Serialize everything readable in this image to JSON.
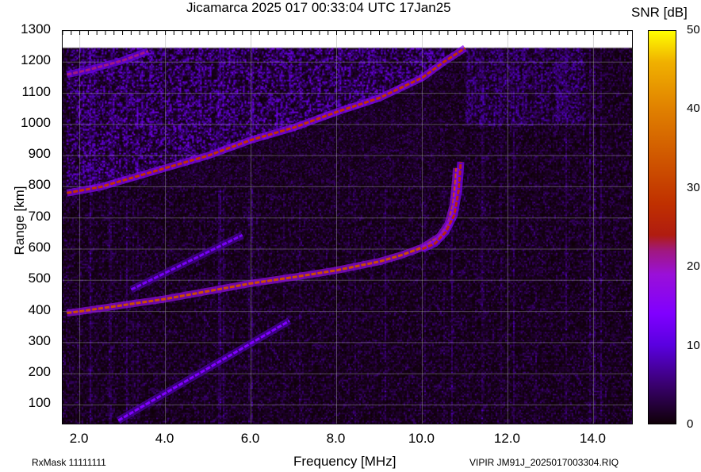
{
  "header": {
    "title": "Jicamarca 2025 017 00:33:04 UTC       17Jan25",
    "colorbar_label": "SNR [dB]"
  },
  "footer": {
    "rxmask": "RxMask 11111111",
    "file": "VIPIR  JM91J_2025017003304.RIQ"
  },
  "chart_data": {
    "type": "heatmap",
    "title": "Jicamarca 2025 017 00:33:04 UTC       17Jan25",
    "xlabel": "Frequency [MHz]",
    "ylabel": "Range [km]",
    "xlim": [
      1.6,
      14.9
    ],
    "ylim": [
      40,
      1300
    ],
    "data_ylim_top": 1245,
    "grid": true,
    "xticks": [
      "2.0",
      "4.0",
      "6.0",
      "8.0",
      "10.0",
      "12.0",
      "14.0"
    ],
    "xtick_values": [
      2,
      4,
      6,
      8,
      10,
      12,
      14
    ],
    "yticks": [
      "1300",
      "1200",
      "1100",
      "1000",
      "900",
      "800",
      "700",
      "600",
      "500",
      "400",
      "300",
      "200",
      "100"
    ],
    "ytick_values": [
      1300,
      1200,
      1100,
      1000,
      900,
      800,
      700,
      600,
      500,
      400,
      300,
      200,
      100
    ],
    "colorbar": {
      "label": "SNR [dB]",
      "range": [
        0,
        50
      ],
      "ticks": [
        "50",
        "40",
        "30",
        "20",
        "10",
        "0"
      ],
      "tick_values": [
        50,
        40,
        30,
        20,
        10,
        0
      ]
    },
    "traces": [
      {
        "name": "F-layer O trace",
        "snr": 32,
        "points": [
          [
            1.7,
            395
          ],
          [
            2,
            400
          ],
          [
            3,
            420
          ],
          [
            4,
            440
          ],
          [
            5,
            465
          ],
          [
            6,
            490
          ],
          [
            7,
            510
          ],
          [
            8,
            532
          ],
          [
            9,
            560
          ],
          [
            9.5,
            580
          ],
          [
            10,
            605
          ],
          [
            10.4,
            640
          ],
          [
            10.6,
            680
          ],
          [
            10.72,
            740
          ],
          [
            10.78,
            820
          ],
          [
            10.8,
            860
          ]
        ]
      },
      {
        "name": "F-layer X trace",
        "snr": 26,
        "points": [
          [
            10.0,
            600
          ],
          [
            10.3,
            618
          ],
          [
            10.55,
            655
          ],
          [
            10.75,
            710
          ],
          [
            10.85,
            790
          ],
          [
            10.9,
            880
          ]
        ]
      },
      {
        "name": "Second hop trace",
        "snr": 28,
        "points": [
          [
            1.7,
            780
          ],
          [
            2.5,
            800
          ],
          [
            3,
            820
          ],
          [
            4,
            860
          ],
          [
            5,
            900
          ],
          [
            6,
            950
          ],
          [
            7,
            990
          ],
          [
            8,
            1040
          ],
          [
            9,
            1085
          ],
          [
            10,
            1150
          ],
          [
            10.5,
            1200
          ],
          [
            11,
            1245
          ]
        ]
      },
      {
        "name": "Third hop trace",
        "snr": 22,
        "points": [
          [
            1.7,
            1160
          ],
          [
            2.2,
            1175
          ],
          [
            3,
            1205
          ],
          [
            3.6,
            1235
          ]
        ]
      },
      {
        "name": "Interference diagonal 1",
        "snr": 14,
        "points": [
          [
            2.9,
            50
          ],
          [
            6.9,
            370
          ]
        ]
      },
      {
        "name": "Interference diagonal 2",
        "snr": 13,
        "points": [
          [
            3.2,
            470
          ],
          [
            5.8,
            645
          ]
        ]
      }
    ],
    "diffuse_regions": [
      {
        "name": "Spread echoes above second hop",
        "freq": [
          1.7,
          10.5
        ],
        "range_km": [
          800,
          1245
        ],
        "snr": 11
      },
      {
        "name": "Diffuse echoes",
        "freq": [
          11,
          13.8
        ],
        "range_km": [
          1000,
          1245
        ],
        "snr": 8
      }
    ]
  }
}
